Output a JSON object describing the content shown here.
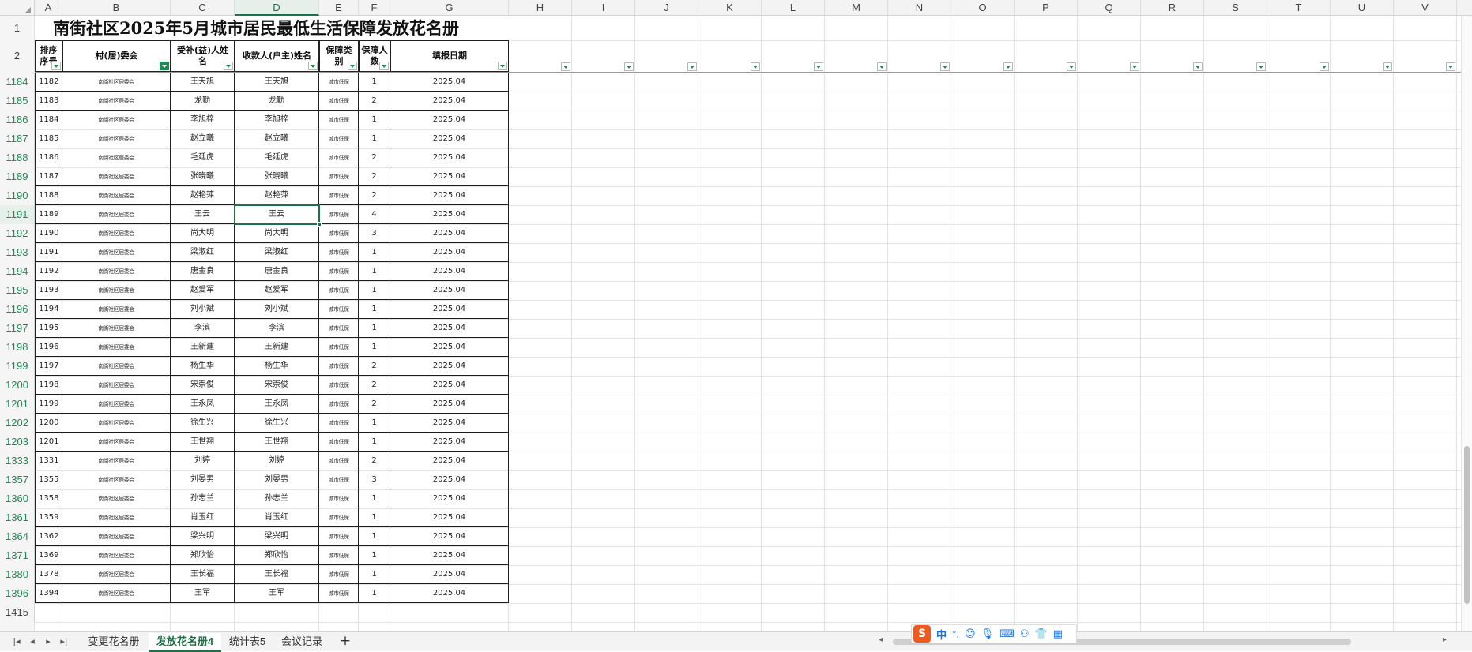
{
  "columns": [
    "A",
    "B",
    "C",
    "D",
    "E",
    "F",
    "G",
    "H",
    "I",
    "J",
    "K",
    "L",
    "M",
    "N",
    "O",
    "P",
    "Q",
    "R",
    "S",
    "T",
    "U",
    "V"
  ],
  "active_column": "D",
  "title": "南街社区2025年5月城市居民最低生活保障发放花名册",
  "headers": {
    "seq": "排序\n序号",
    "committee": "村(居)委会",
    "recipient": "受补(益)人姓\n名",
    "payee": "收款人(户主)姓名",
    "type": "保障类\n别",
    "count": "保障人\n数",
    "date": "填报日期"
  },
  "header_row_labels": [
    "1",
    "2"
  ],
  "rows": [
    {
      "row": "1184",
      "seq": "1182",
      "committee": "南街社区居委会",
      "recipient": "王天旭",
      "payee": "王天旭",
      "type": "城市低保",
      "count": "1",
      "date": "2025.04"
    },
    {
      "row": "1185",
      "seq": "1183",
      "committee": "南街社区居委会",
      "recipient": "龙勤",
      "payee": "龙勤",
      "type": "城市低保",
      "count": "2",
      "date": "2025.04"
    },
    {
      "row": "1186",
      "seq": "1184",
      "committee": "南街社区居委会",
      "recipient": "李旭梓",
      "payee": "李旭梓",
      "type": "城市低保",
      "count": "1",
      "date": "2025.04"
    },
    {
      "row": "1187",
      "seq": "1185",
      "committee": "南街社区居委会",
      "recipient": "赵立曦",
      "payee": "赵立曦",
      "type": "城市低保",
      "count": "1",
      "date": "2025.04"
    },
    {
      "row": "1188",
      "seq": "1186",
      "committee": "南街社区居委会",
      "recipient": "毛廷虎",
      "payee": "毛廷虎",
      "type": "城市低保",
      "count": "2",
      "date": "2025.04"
    },
    {
      "row": "1189",
      "seq": "1187",
      "committee": "南街社区居委会",
      "recipient": "张晓曦",
      "payee": "张晓曦",
      "type": "城市低保",
      "count": "2",
      "date": "2025.04"
    },
    {
      "row": "1190",
      "seq": "1188",
      "committee": "南街社区居委会",
      "recipient": "赵艳萍",
      "payee": "赵艳萍",
      "type": "城市低保",
      "count": "2",
      "date": "2025.04"
    },
    {
      "row": "1191",
      "seq": "1189",
      "committee": "南街社区居委会",
      "recipient": "王云",
      "payee": "王云",
      "type": "城市低保",
      "count": "4",
      "date": "2025.04"
    },
    {
      "row": "1192",
      "seq": "1190",
      "committee": "南街社区居委会",
      "recipient": "尚大明",
      "payee": "尚大明",
      "type": "城市低保",
      "count": "3",
      "date": "2025.04"
    },
    {
      "row": "1193",
      "seq": "1191",
      "committee": "南街社区居委会",
      "recipient": "梁淑红",
      "payee": "梁淑红",
      "type": "城市低保",
      "count": "1",
      "date": "2025.04"
    },
    {
      "row": "1194",
      "seq": "1192",
      "committee": "南街社区居委会",
      "recipient": "唐金良",
      "payee": "唐金良",
      "type": "城市低保",
      "count": "1",
      "date": "2025.04"
    },
    {
      "row": "1195",
      "seq": "1193",
      "committee": "南街社区居委会",
      "recipient": "赵爱军",
      "payee": "赵爱军",
      "type": "城市低保",
      "count": "1",
      "date": "2025.04"
    },
    {
      "row": "1196",
      "seq": "1194",
      "committee": "南街社区居委会",
      "recipient": "刘小斌",
      "payee": "刘小斌",
      "type": "城市低保",
      "count": "1",
      "date": "2025.04"
    },
    {
      "row": "1197",
      "seq": "1195",
      "committee": "南街社区居委会",
      "recipient": "李滨",
      "payee": "李滨",
      "type": "城市低保",
      "count": "1",
      "date": "2025.04"
    },
    {
      "row": "1198",
      "seq": "1196",
      "committee": "南街社区居委会",
      "recipient": "王新建",
      "payee": "王新建",
      "type": "城市低保",
      "count": "1",
      "date": "2025.04"
    },
    {
      "row": "1199",
      "seq": "1197",
      "committee": "南街社区居委会",
      "recipient": "杨生华",
      "payee": "杨生华",
      "type": "城市低保",
      "count": "2",
      "date": "2025.04"
    },
    {
      "row": "1200",
      "seq": "1198",
      "committee": "南街社区居委会",
      "recipient": "宋崇俊",
      "payee": "宋崇俊",
      "type": "城市低保",
      "count": "2",
      "date": "2025.04"
    },
    {
      "row": "1201",
      "seq": "1199",
      "committee": "南街社区居委会",
      "recipient": "王永凤",
      "payee": "王永凤",
      "type": "城市低保",
      "count": "2",
      "date": "2025.04"
    },
    {
      "row": "1202",
      "seq": "1200",
      "committee": "南街社区居委会",
      "recipient": "徐生兴",
      "payee": "徐生兴",
      "type": "城市低保",
      "count": "1",
      "date": "2025.04"
    },
    {
      "row": "1203",
      "seq": "1201",
      "committee": "南街社区居委会",
      "recipient": "王世翔",
      "payee": "王世翔",
      "type": "城市低保",
      "count": "1",
      "date": "2025.04"
    },
    {
      "row": "1333",
      "seq": "1331",
      "committee": "南街社区居委会",
      "recipient": "刘婷",
      "payee": "刘婷",
      "type": "城市低保",
      "count": "2",
      "date": "2025.04"
    },
    {
      "row": "1357",
      "seq": "1355",
      "committee": "南街社区居委会",
      "recipient": "刘晏男",
      "payee": "刘晏男",
      "type": "城市低保",
      "count": "3",
      "date": "2025.04"
    },
    {
      "row": "1360",
      "seq": "1358",
      "committee": "南街社区居委会",
      "recipient": "孙志兰",
      "payee": "孙志兰",
      "type": "城市低保",
      "count": "1",
      "date": "2025.04"
    },
    {
      "row": "1361",
      "seq": "1359",
      "committee": "南街社区居委会",
      "recipient": "肖玉红",
      "payee": "肖玉红",
      "type": "城市低保",
      "count": "1",
      "date": "2025.04"
    },
    {
      "row": "1364",
      "seq": "1362",
      "committee": "南街社区居委会",
      "recipient": "梁兴明",
      "payee": "梁兴明",
      "type": "城市低保",
      "count": "1",
      "date": "2025.04"
    },
    {
      "row": "1371",
      "seq": "1369",
      "committee": "南街社区居委会",
      "recipient": "郑欣怡",
      "payee": "郑欣怡",
      "type": "城市低保",
      "count": "1",
      "date": "2025.04"
    },
    {
      "row": "1380",
      "seq": "1378",
      "committee": "南街社区居委会",
      "recipient": "王长福",
      "payee": "王长福",
      "type": "城市低保",
      "count": "1",
      "date": "2025.04"
    },
    {
      "row": "1396",
      "seq": "1394",
      "committee": "南街社区居委会",
      "recipient": "王军",
      "payee": "王军",
      "type": "城市低保",
      "count": "1",
      "date": "2025.04"
    }
  ],
  "extra_row_label": "1415",
  "selected_row": "1191",
  "selected_column": "D",
  "sheet_tabs": [
    {
      "label": "变更花名册",
      "active": false
    },
    {
      "label": "发放花名册4",
      "active": true
    },
    {
      "label": "统计表5",
      "active": false
    },
    {
      "label": "会议记录",
      "active": false
    }
  ],
  "add_sheet": "+",
  "ime_toolbar": {
    "lang": "中",
    "punct": "°,"
  },
  "colors": {
    "accent": "#1e8a52",
    "grid": "#e2e2e2",
    "selection": "#1e7145"
  }
}
